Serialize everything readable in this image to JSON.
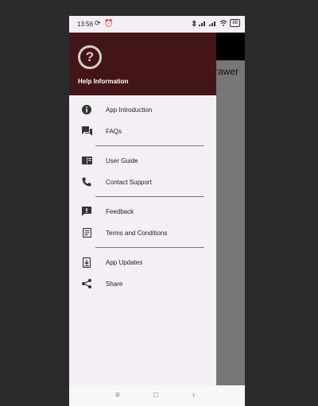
{
  "status_bar": {
    "time": "13:56",
    "left_icons": "⟳ ⏰",
    "right_icons": [
      "bluetooth-icon",
      "signal-icon",
      "signal-icon",
      "wifi-icon"
    ],
    "battery": "88"
  },
  "app": {
    "title_partial": "rawer"
  },
  "drawer": {
    "header_title": "Help Information",
    "header_icon": "help-icon",
    "header_bg": "#441517",
    "items": [
      {
        "label": "App Introduction",
        "icon": "info-icon"
      },
      {
        "label": "FAQs",
        "icon": "forum-icon"
      },
      {
        "label": "User Guide",
        "icon": "book-icon"
      },
      {
        "label": "Contact Support",
        "icon": "phone-icon"
      },
      {
        "label": "Feedback",
        "icon": "feedback-icon"
      },
      {
        "label": "Terms and Conditions",
        "icon": "document-icon"
      },
      {
        "label": "App Updates",
        "icon": "download-icon"
      },
      {
        "label": "Share",
        "icon": "share-icon"
      }
    ]
  },
  "nav_bar": {
    "menu": "≡",
    "home": "□",
    "back": "‹"
  }
}
